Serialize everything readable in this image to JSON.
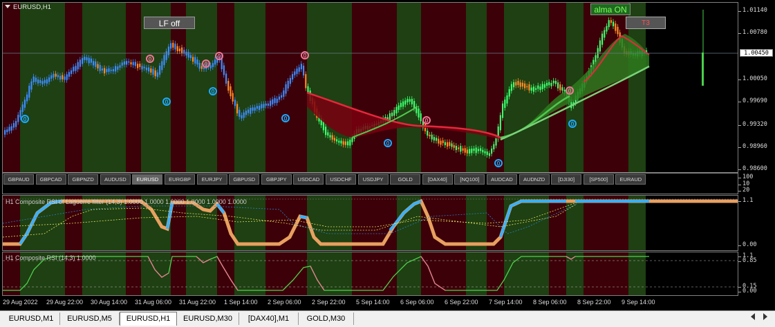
{
  "chart": {
    "title": "EURUSD,H1",
    "lf_button": "LF off",
    "alma_button": "alma ON",
    "t3_button": "T3",
    "current_price": "1.00450",
    "price_ticks": [
      "1.01140",
      "1.00780",
      "1.00450",
      "1.00050",
      "0.99690",
      "0.99320",
      "0.98960",
      "0.98600"
    ],
    "signal_label": "0"
  },
  "symbols": [
    "GBPAUD",
    "GBPCAD",
    "GBPNZD",
    "AUDUSD",
    "EURUSD",
    "EURGBP",
    "EURJPY",
    "GBPUSD",
    "GBPJPY",
    "USDCAD",
    "USDCHF",
    "USDJPY",
    "GOLD",
    "[DAX40]",
    "[NQ100]",
    "AUDCAD",
    "AUDNZD",
    "[DJI30]",
    "[SP500]",
    "EURAUD"
  ],
  "active_symbol": "EURUSD",
  "symbol_pane_ticks": [
    "100",
    "10",
    "20"
  ],
  "indicator1": {
    "title": "H1 Composite RSI of Laguerre filter (14,3) 1.0000 1.0000 1.0000 1.0000 1.0000 1.0000",
    "ticks": [
      "1.1",
      "0.00"
    ]
  },
  "indicator2": {
    "title": "H1 Composite RSI (14,3) 1.0000",
    "ticks": [
      "1.1",
      "0.85",
      "0.15",
      "0.00"
    ]
  },
  "time_labels": [
    "29 Aug 2022",
    "29 Aug 22:00",
    "30 Aug 14:00",
    "31 Aug 06:00",
    "31 Aug 22:00",
    "1 Sep 14:00",
    "2 Sep 06:00",
    "2 Sep 22:00",
    "5 Sep 14:00",
    "6 Sep 06:00",
    "6 Sep 22:00",
    "7 Sep 14:00",
    "8 Sep 06:00",
    "8 Sep 22:00",
    "9 Sep 14:00"
  ],
  "tabs": [
    "EURUSD,M1",
    "EURUSD,M5",
    "EURUSD,H1",
    "EURUSD,M30",
    "[DAX40],M1",
    "GOLD,M30"
  ],
  "active_tab": "EURUSD,H1",
  "colors": {
    "bg_green": "#1e4012",
    "bg_red": "#3c0008",
    "bull": "#3c8cff",
    "bear": "#ff8c28",
    "bull2": "#3cff6e",
    "ma_red": "#e6283c",
    "ma_green": "#50c850",
    "marker_blue": "#1eaaff",
    "marker_pink": "#f07896"
  }
}
